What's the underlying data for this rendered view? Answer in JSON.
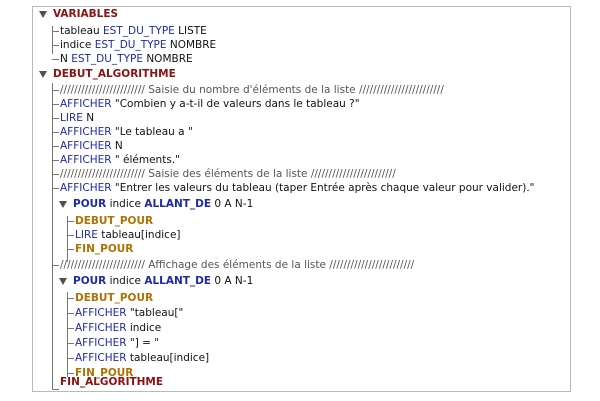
{
  "tree": {
    "variables": {
      "label": "VARIABLES",
      "items": [
        {
          "name": "tableau",
          "kw": "EST_DU_TYPE",
          "type": "LISTE"
        },
        {
          "name": "indice",
          "kw": "EST_DU_TYPE",
          "type": "NOMBRE"
        },
        {
          "name": "N",
          "kw": "EST_DU_TYPE",
          "type": "NOMBRE"
        }
      ]
    },
    "debut": "DEBUT_ALGORITHME",
    "lines": [
      {
        "kind": "comment",
        "text": "//////////////////////// Saisie du nombre d'éléments de la liste ////////////////////////"
      },
      {
        "kind": "stmt",
        "kw": "AFFICHER",
        "arg": "\"Combien y a-t-il de valeurs dans le tableau ?\""
      },
      {
        "kind": "stmt",
        "kw": "LIRE",
        "arg": "N"
      },
      {
        "kind": "stmt",
        "kw": "AFFICHER",
        "arg": "\"Le tableau a  \""
      },
      {
        "kind": "stmt",
        "kw": "AFFICHER",
        "arg": "N"
      },
      {
        "kind": "stmt",
        "kw": "AFFICHER",
        "arg": "\"  éléments.\""
      },
      {
        "kind": "comment",
        "text": "//////////////////////// Saisie des éléments de la liste ////////////////////////"
      },
      {
        "kind": "stmt",
        "kw": "AFFICHER",
        "arg": "\"Entrer les valeurs du tableau (taper Entrée après chaque valeur pour valider).\""
      }
    ],
    "loop1": {
      "kw": "POUR",
      "var": "indice",
      "kw2": "ALLANT_DE",
      "range": "0 A N-1",
      "debut": "DEBUT_POUR",
      "fin": "FIN_POUR",
      "body": [
        {
          "kw": "LIRE",
          "arg": "tableau[indice]"
        }
      ]
    },
    "comment3": "//////////////////////// Affichage des éléments de la liste ////////////////////////",
    "loop2": {
      "kw": "POUR",
      "var": "indice",
      "kw2": "ALLANT_DE",
      "range": "0 A N-1",
      "debut": "DEBUT_POUR",
      "fin": "FIN_POUR",
      "body": [
        {
          "kw": "AFFICHER",
          "arg": "\"tableau[\""
        },
        {
          "kw": "AFFICHER",
          "arg": "indice"
        },
        {
          "kw": "AFFICHER",
          "arg": "\"] = \""
        },
        {
          "kw": "AFFICHER",
          "arg": "tableau[indice]"
        }
      ]
    },
    "fin": "FIN_ALGORITHME"
  }
}
